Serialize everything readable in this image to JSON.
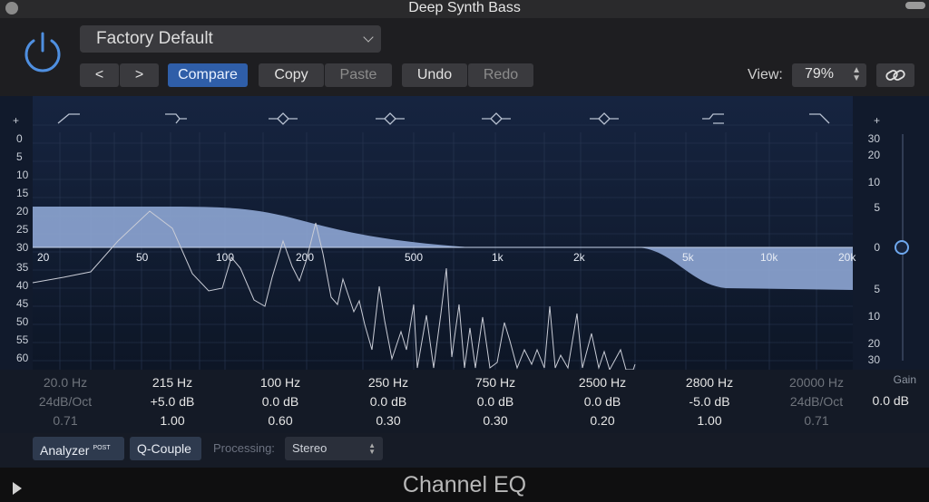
{
  "window": {
    "title": "Deep Synth Bass"
  },
  "header": {
    "preset": "Factory Default",
    "nav_prev": "<",
    "nav_next": ">",
    "compare": "Compare",
    "copy": "Copy",
    "paste": "Paste",
    "undo": "Undo",
    "redo": "Redo",
    "view_label": "View:",
    "view_value": "79%"
  },
  "graph": {
    "left_scale": [
      "+",
      "0",
      "5",
      "10",
      "15",
      "20",
      "25",
      "30",
      "35",
      "40",
      "45",
      "50",
      "55",
      "60",
      "-"
    ],
    "right_scale": [
      "+",
      "30",
      "20",
      "10",
      "5",
      "0",
      "5",
      "10",
      "20",
      "30",
      "-"
    ],
    "freq_labels": [
      "20",
      "50",
      "100",
      "200",
      "500",
      "1k",
      "2k",
      "5k",
      "10k",
      "20k"
    ]
  },
  "bands": [
    {
      "freq": "20.0 Hz",
      "gain": "24dB/Oct",
      "q": "0.71",
      "enabled": false
    },
    {
      "freq": "215 Hz",
      "gain": "+5.0 dB",
      "q": "1.00",
      "enabled": true
    },
    {
      "freq": "100 Hz",
      "gain": "0.0 dB",
      "q": "0.60",
      "enabled": true
    },
    {
      "freq": "250 Hz",
      "gain": "0.0 dB",
      "q": "0.30",
      "enabled": true
    },
    {
      "freq": "750 Hz",
      "gain": "0.0 dB",
      "q": "0.30",
      "enabled": true
    },
    {
      "freq": "2500 Hz",
      "gain": "0.0 dB",
      "q": "0.20",
      "enabled": true
    },
    {
      "freq": "2800 Hz",
      "gain": "-5.0 dB",
      "q": "1.00",
      "enabled": true
    },
    {
      "freq": "20000 Hz",
      "gain": "24dB/Oct",
      "q": "0.71",
      "enabled": false
    }
  ],
  "gain": {
    "label": "Gain",
    "value": "0.0 dB"
  },
  "controls": {
    "analyzer": "Analyzer",
    "analyzer_badge": "POST",
    "qcouple": "Q-Couple",
    "processing_label": "Processing:",
    "processing_value": "Stereo"
  },
  "footer": {
    "plugin_name": "Channel EQ"
  },
  "colors": {
    "accent": "#2f5ea8",
    "curve_fill": "#8ea6d4",
    "background": "#111a2c"
  }
}
